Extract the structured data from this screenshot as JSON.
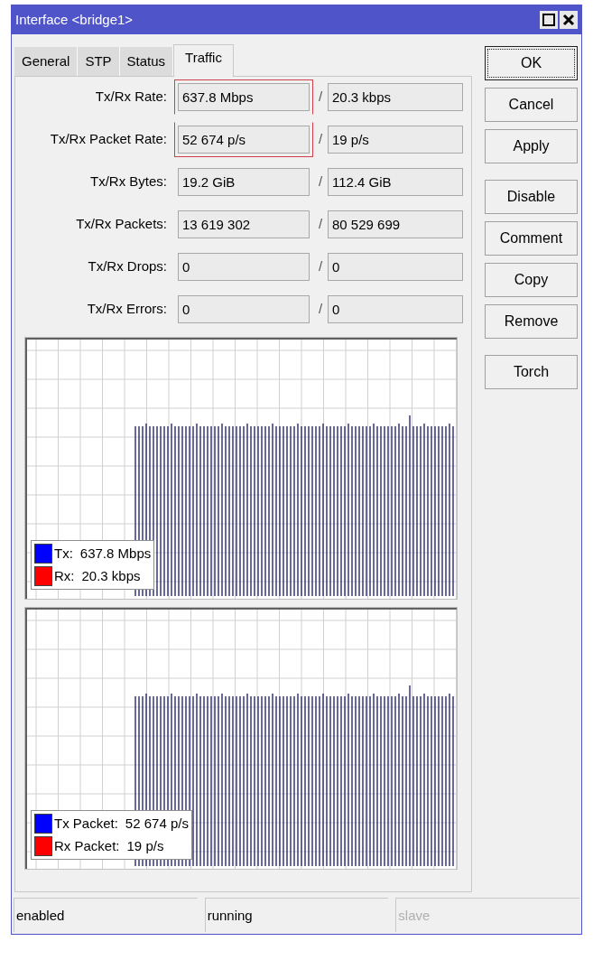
{
  "window": {
    "title": "Interface <bridge1>"
  },
  "tabs": [
    {
      "label": "General",
      "selected": false
    },
    {
      "label": "STP",
      "selected": false
    },
    {
      "label": "Status",
      "selected": false
    },
    {
      "label": "Traffic",
      "selected": true
    }
  ],
  "stats": [
    {
      "label": "Tx/Rx Rate:",
      "tx": "637.8 Mbps",
      "rx": "20.3 kbps",
      "highlighted": true
    },
    {
      "label": "Tx/Rx Packet Rate:",
      "tx": "52 674 p/s",
      "rx": "19 p/s",
      "highlighted": true
    },
    {
      "label": "Tx/Rx Bytes:",
      "tx": "19.2 GiB",
      "rx": "112.4 GiB",
      "highlighted": false
    },
    {
      "label": "Tx/Rx Packets:",
      "tx": "13 619 302",
      "rx": "80 529 699",
      "highlighted": false
    },
    {
      "label": "Tx/Rx Drops:",
      "tx": "0",
      "rx": "0",
      "highlighted": false
    },
    {
      "label": "Tx/Rx Errors:",
      "tx": "0",
      "rx": "0",
      "highlighted": false
    }
  ],
  "separator": "/",
  "graphs": [
    {
      "legend": [
        {
          "label": "Tx:",
          "value": "637.8 Mbps",
          "color": "#0000ff"
        },
        {
          "label": "Rx:",
          "value": "20.3 kbps",
          "color": "#ff0000"
        }
      ]
    },
    {
      "legend": [
        {
          "label": "Tx Packet:",
          "value": "52 674 p/s",
          "color": "#0000ff"
        },
        {
          "label": "Rx Packet:",
          "value": "19 p/s",
          "color": "#ff0000"
        }
      ]
    }
  ],
  "button_groups": [
    [
      {
        "label": "OK",
        "focused": true
      },
      {
        "label": "Cancel",
        "focused": false
      },
      {
        "label": "Apply",
        "focused": false
      }
    ],
    [
      {
        "label": "Disable",
        "focused": false
      },
      {
        "label": "Comment",
        "focused": false
      },
      {
        "label": "Copy",
        "focused": false
      },
      {
        "label": "Remove",
        "focused": false
      }
    ],
    [
      {
        "label": "Torch",
        "focused": false
      }
    ]
  ],
  "status_bar": [
    {
      "text": "enabled",
      "disabled": false
    },
    {
      "text": "running",
      "disabled": false
    },
    {
      "text": "slave",
      "disabled": true
    }
  ]
}
